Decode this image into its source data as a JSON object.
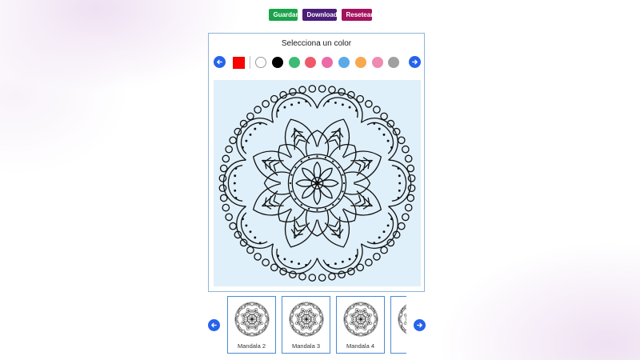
{
  "toolbar": {
    "save_label": "Guardar",
    "download_label": "Download",
    "reset_label": "Resetear"
  },
  "palette": {
    "title": "Selecciona un color",
    "selected_color": "#ff0000",
    "swatches": [
      "#ffffff",
      "#000000",
      "#3dbb74",
      "#ee5a6a",
      "#ec6aa8",
      "#5aaae8",
      "#f7a94e",
      "#ef8ab2",
      "#a0a0a0"
    ]
  },
  "canvas": {
    "background": "#e0f0fa",
    "image": "mandala-line-art"
  },
  "thumbnails": {
    "items": [
      {
        "label": "Mandala 2"
      },
      {
        "label": "Mandala 3"
      },
      {
        "label": "Mandala 4"
      },
      {
        "label": "M"
      }
    ]
  },
  "icons": {
    "prev": "arrow-left-icon",
    "next": "arrow-right-icon"
  }
}
